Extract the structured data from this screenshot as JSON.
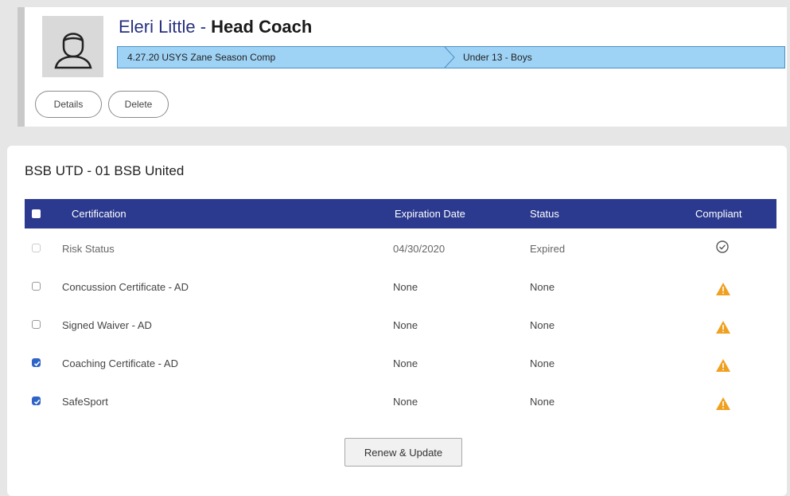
{
  "profile": {
    "name": "Eleri Little",
    "separator": " - ",
    "role": "Head Coach",
    "breadcrumb": [
      "4.27.20 USYS Zane Season Comp",
      "Under 13 - Boys"
    ],
    "buttons": {
      "details": "Details",
      "delete": "Delete"
    }
  },
  "team": {
    "title": "BSB UTD - 01 BSB United"
  },
  "table": {
    "headers": {
      "certification": "Certification",
      "expiration": "Expiration Date",
      "status": "Status",
      "compliant": "Compliant"
    },
    "rows": [
      {
        "certification": "Risk Status",
        "expiration": "04/30/2020",
        "status": "Expired",
        "checked": false,
        "compliant_icon": "check-circle-icon"
      },
      {
        "certification": "Concussion Certificate - AD",
        "expiration": "None",
        "status": "None",
        "checked": false,
        "compliant_icon": "warning-icon"
      },
      {
        "certification": "Signed Waiver - AD",
        "expiration": "None",
        "status": "None",
        "checked": false,
        "compliant_icon": "warning-icon"
      },
      {
        "certification": "Coaching Certificate - AD",
        "expiration": "None",
        "status": "None",
        "checked": true,
        "compliant_icon": "warning-icon"
      },
      {
        "certification": "SafeSport",
        "expiration": "None",
        "status": "None",
        "checked": true,
        "compliant_icon": "warning-icon"
      }
    ]
  },
  "actions": {
    "renew": "Renew & Update"
  },
  "colors": {
    "header_bg": "#2b3a8f",
    "name": "#27317e",
    "breadcrumb_bg": "#9fd3f6",
    "warning": "#f0a020",
    "checkbox_checked": "#2f63c8"
  }
}
